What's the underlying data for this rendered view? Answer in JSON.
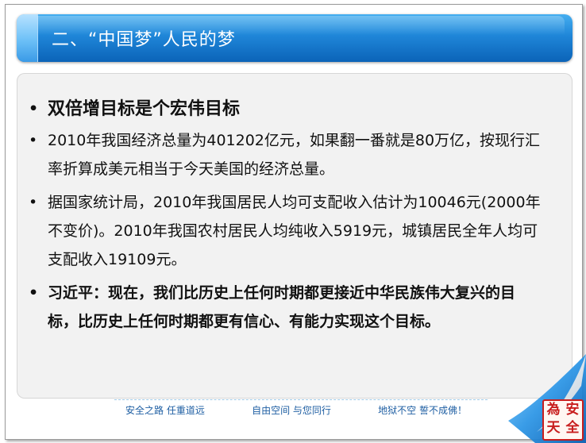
{
  "slide": {
    "title": "二、“中国梦”人民的梦",
    "bullets": [
      {
        "text": "双倍增目标是个宏伟目标",
        "style": "first"
      },
      {
        "text": "2010年我国经济总量为401202亿元，如果翻一番就是80万亿，按现行汇率折算成美元相当于今天美国的经济总量。",
        "style": "normal"
      },
      {
        "text": "据国家统计局，2010年我国居民人均可支配收入估计为10046元(2000年不变价)。2010年我国农村居民人均纯收入5919元，城镇居民全年人均可支配收入19109元。",
        "style": "normal"
      },
      {
        "text": "习近平：现在，我们比历史上任何时期都更接近中华民族伟大复兴的目标，比历史上任何时期都更有信心、有能力实现这个目标。",
        "style": "strong"
      }
    ],
    "bullet_glyph": "•",
    "footer": {
      "slogan1": "安全之路 任重道远",
      "slogan2": "自由空间 与您同行",
      "slogan3": "地狱不空 誓不成佛！"
    },
    "seal": {
      "chars": [
        "為",
        "安",
        "天",
        "全"
      ],
      "color": "#c81e1e"
    },
    "colors": {
      "title_bar": "#1f86d8",
      "title_accent": "#6cc0f7",
      "footer_text": "#1f5fa3"
    }
  }
}
